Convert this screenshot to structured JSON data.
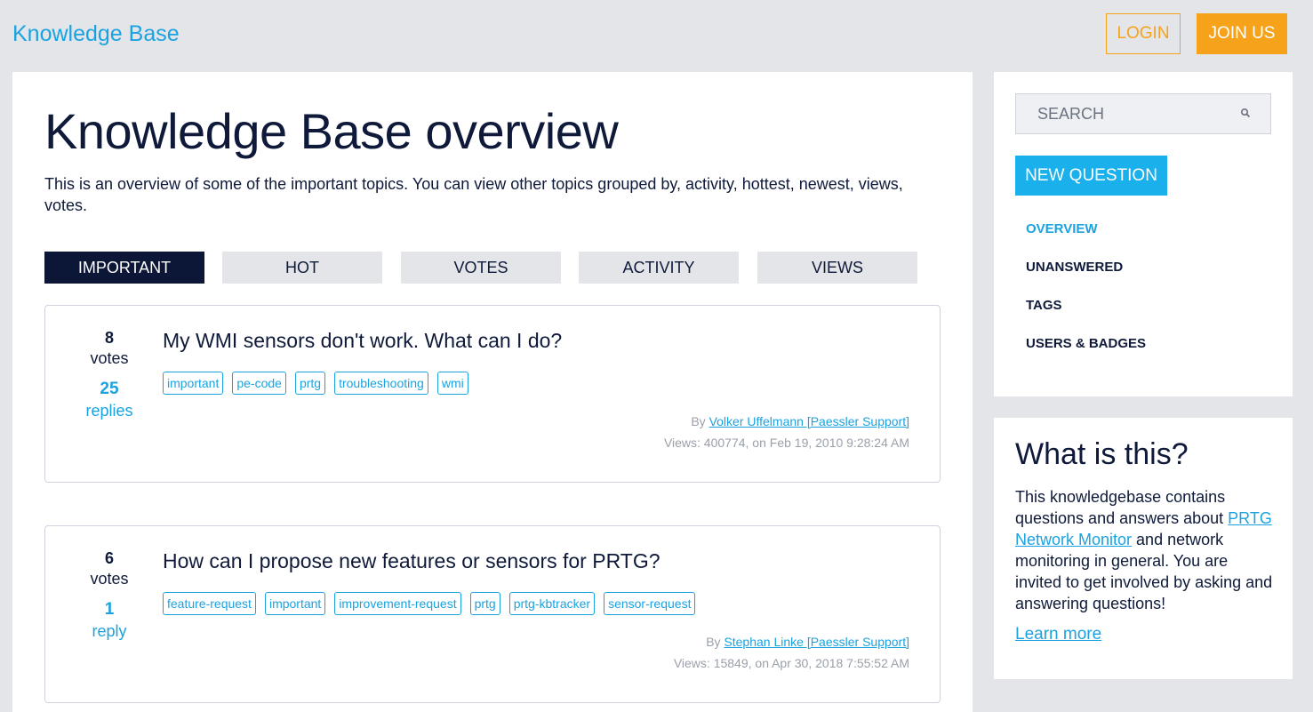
{
  "header": {
    "brand": "Knowledge Base",
    "login_label": "LOGIN",
    "join_label": "JOIN US"
  },
  "main": {
    "title": "Knowledge Base overview",
    "intro": "This is an overview of some of the important topics. You can view other topics grouped by, activity, hottest, newest, views, votes.",
    "tabs": [
      {
        "label": "IMPORTANT",
        "active": true
      },
      {
        "label": "HOT"
      },
      {
        "label": "VOTES"
      },
      {
        "label": "ACTIVITY"
      },
      {
        "label": "VIEWS"
      }
    ],
    "questions": [
      {
        "votes": "8",
        "votes_label": "votes",
        "replies": "25",
        "replies_label": "replies",
        "title": "My WMI sensors don't work. What can I do?",
        "tags": [
          "important",
          "pe-code",
          "prtg",
          "troubleshooting",
          "wmi"
        ],
        "by_prefix": "By",
        "author": "Volker Uffelmann [Paessler Support]",
        "meta": "Views: 400774, on Feb 19, 2010 9:28:24 AM"
      },
      {
        "votes": "6",
        "votes_label": "votes",
        "replies": "1",
        "replies_label": "reply",
        "title": "How can I propose new features or sensors for PRTG?",
        "tags": [
          "feature-request",
          "important",
          "improvement-request",
          "prtg",
          "prtg-kbtracker",
          "sensor-request"
        ],
        "by_prefix": "By",
        "author": "Stephan Linke [Paessler Support]",
        "meta": "Views: 15849, on Apr 30, 2018 7:55:52 AM"
      }
    ]
  },
  "sidebar": {
    "search_placeholder": "SEARCH",
    "new_question_label": "NEW QUESTION",
    "nav": [
      {
        "label": "OVERVIEW",
        "active": true
      },
      {
        "label": "UNANSWERED"
      },
      {
        "label": "TAGS"
      },
      {
        "label": "USERS & BADGES"
      }
    ],
    "about": {
      "title": "What is this?",
      "text_before": "This knowledgebase contains questions and answers about ",
      "link": "PRTG Network Monitor",
      "text_after": " and network monitoring in general. You are invited to get involved by asking and answering questions!",
      "learn_more": "Learn more"
    }
  },
  "colors": {
    "accent_blue": "#1aa3e0",
    "accent_orange": "#f7a21b",
    "navy": "#0c1636",
    "page_bg": "#e4e5e9"
  }
}
